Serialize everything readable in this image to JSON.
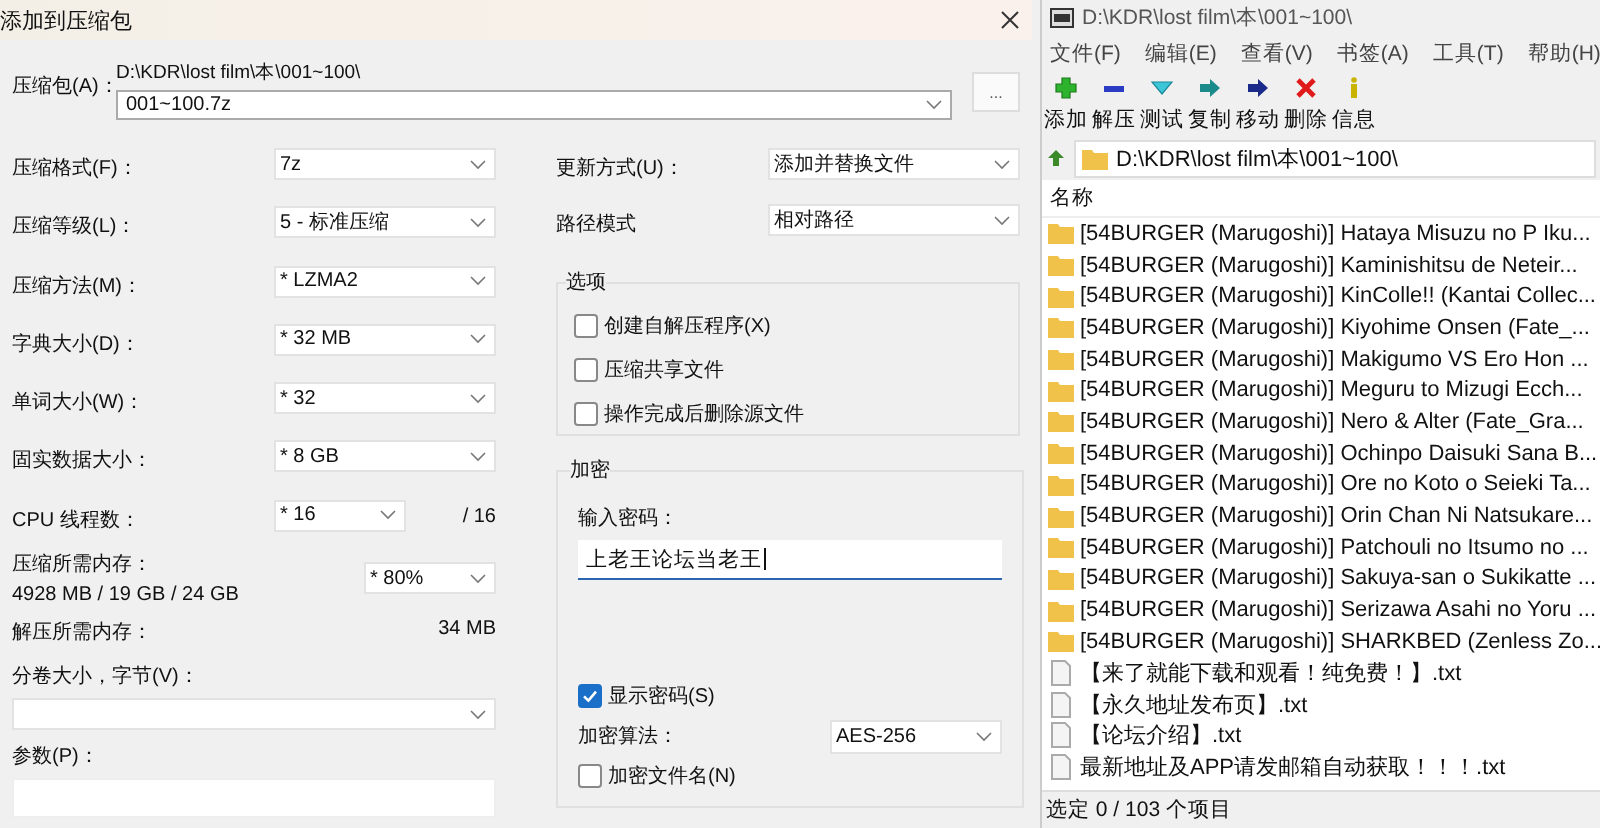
{
  "dialog": {
    "title": "添加到压缩包",
    "archive": {
      "label": "压缩包(A)：",
      "path": "D:\\KDR\\lost film\\本\\001~100\\",
      "value": "001~100.7z",
      "browse": "..."
    },
    "left_fields": [
      {
        "label": "压缩格式(F)：",
        "value": "7z"
      },
      {
        "label": "压缩等级(L)：",
        "value": "5 - 标准压缩"
      },
      {
        "label": "压缩方法(M)：",
        "value": "* LZMA2"
      },
      {
        "label": "字典大小(D)：",
        "value": "* 32 MB"
      },
      {
        "label": "单词大小(W)：",
        "value": "* 32"
      },
      {
        "label": "固实数据大小：",
        "value": "* 8 GB"
      },
      {
        "label": "CPU 线程数：",
        "value": "* 16",
        "suffix": "/ 16"
      }
    ],
    "memory": {
      "label": "压缩所需内存：",
      "detail": "4928 MB / 19 GB / 24 GB",
      "value": "* 80%"
    },
    "decompress_memory": {
      "label": "解压所需内存：",
      "value": "34 MB"
    },
    "volume": {
      "label": "分卷大小，字节(V)："
    },
    "parameters": {
      "label": "参数(P)："
    },
    "right_fields": [
      {
        "label": "更新方式(U)：",
        "value": "添加并替换文件"
      },
      {
        "label": "路径模式",
        "value": "相对路径"
      }
    ],
    "options": {
      "title": "选项",
      "items": [
        {
          "label": "创建自解压程序(X)",
          "checked": false
        },
        {
          "label": "压缩共享文件",
          "checked": false
        },
        {
          "label": "操作完成后删除源文件",
          "checked": false
        }
      ]
    },
    "encryption": {
      "title": "加密",
      "password_label": "输入密码：",
      "password": "上老王论坛当老王",
      "show_password": {
        "label": "显示密码(S)",
        "checked": true
      },
      "method_label": "加密算法：",
      "method": "AES-256",
      "encrypt_names": {
        "label": "加密文件名(N)",
        "checked": false
      }
    }
  },
  "explorer": {
    "title": "D:\\KDR\\lost film\\本\\001~100\\",
    "menu": [
      "文件(F)",
      "编辑(E)",
      "查看(V)",
      "书签(A)",
      "工具(T)",
      "帮助(H)"
    ],
    "toolbar": [
      {
        "label": "添加",
        "kind": "add"
      },
      {
        "label": "解压",
        "kind": "extract"
      },
      {
        "label": "测试",
        "kind": "test"
      },
      {
        "label": "复制",
        "kind": "copy"
      },
      {
        "label": "移动",
        "kind": "move"
      },
      {
        "label": "删除",
        "kind": "delete"
      },
      {
        "label": "信息",
        "kind": "info"
      }
    ],
    "address": "D:\\KDR\\lost film\\本\\001~100\\",
    "column": "名称",
    "items": [
      {
        "name": "[54BURGER (Marugoshi)] Hataya Misuzu no P Iku...",
        "kind": "folder"
      },
      {
        "name": "[54BURGER (Marugoshi)] Kaminishitsu de Neteir...",
        "kind": "folder"
      },
      {
        "name": "[54BURGER (Marugoshi)] KinColle!! (Kantai Collec...",
        "kind": "folder"
      },
      {
        "name": "[54BURGER (Marugoshi)] Kiyohime Onsen (Fate_...",
        "kind": "folder"
      },
      {
        "name": "[54BURGER (Marugoshi)] Makigumo VS Ero Hon ...",
        "kind": "folder"
      },
      {
        "name": "[54BURGER (Marugoshi)] Meguru to Mizugi Ecch...",
        "kind": "folder"
      },
      {
        "name": "[54BURGER (Marugoshi)] Nero & Alter (Fate_Gra...",
        "kind": "folder"
      },
      {
        "name": "[54BURGER (Marugoshi)] Ochinpo Daisuki Sana B...",
        "kind": "folder"
      },
      {
        "name": "[54BURGER (Marugoshi)] Ore no Koto o Seieki Ta...",
        "kind": "folder"
      },
      {
        "name": "[54BURGER (Marugoshi)] Orin Chan Ni Natsukare...",
        "kind": "folder"
      },
      {
        "name": "[54BURGER (Marugoshi)] Patchouli no Itsumo no ...",
        "kind": "folder"
      },
      {
        "name": "[54BURGER (Marugoshi)] Sakuya-san o Sukikatte ...",
        "kind": "folder"
      },
      {
        "name": "[54BURGER (Marugoshi)] Serizawa Asahi no Yoru ...",
        "kind": "folder"
      },
      {
        "name": "[54BURGER (Marugoshi)] SHARKBED (Zenless Zo...",
        "kind": "folder"
      },
      {
        "name": "【来了就能下载和观看！纯免费！】.txt",
        "kind": "file"
      },
      {
        "name": "【永久地址发布页】.txt",
        "kind": "file"
      },
      {
        "name": "【论坛介绍】.txt",
        "kind": "file"
      },
      {
        "name": "最新地址及APP请发邮箱自动获取！！！.txt",
        "kind": "file"
      }
    ],
    "status": "选定 0 / 103 个项目"
  }
}
